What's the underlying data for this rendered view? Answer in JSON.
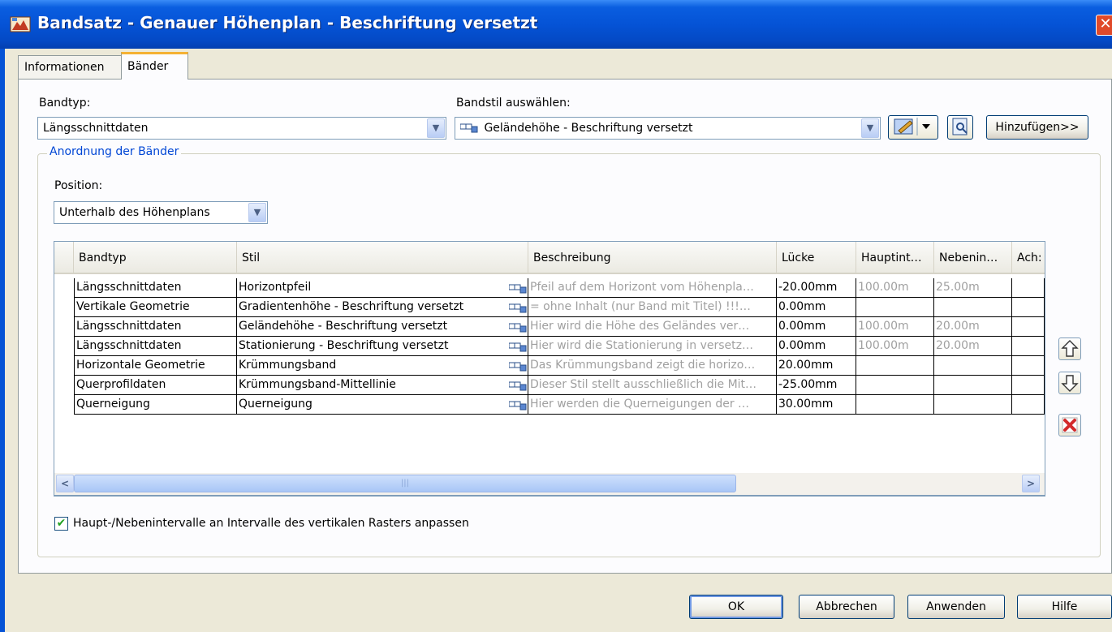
{
  "window": {
    "title": "Bandsatz - Genauer Höhenplan - Beschriftung versetzt",
    "close_glyph": "✕"
  },
  "tabs": [
    {
      "label": "Informationen",
      "active": false
    },
    {
      "label": "Bänder",
      "active": true
    }
  ],
  "band_type": {
    "label": "Bandtyp:",
    "value": "Längsschnittdaten"
  },
  "band_style": {
    "label": "Bandstil auswählen:",
    "value": "Geländehöhe - Beschriftung versetzt",
    "add_button": "Hinzufügen>>"
  },
  "arrangement": {
    "legend": "Anordnung der Bänder",
    "position_label": "Position:",
    "position_value": "Unterhalb des Höhenplans"
  },
  "table": {
    "columns": [
      "Bandtyp",
      "Stil",
      "Beschreibung",
      "Lücke",
      "Hauptint…",
      "Nebenin…",
      "Ach:"
    ],
    "rows": [
      {
        "bandtyp": "Längsschnittdaten",
        "stil": "Horizontpfeil",
        "beschreibung": "Pfeil auf dem Horizont vom Höhenpla…",
        "luecke": "-20.00mm",
        "haupt": "100.00m",
        "neben": "25.00m"
      },
      {
        "bandtyp": "Vertikale Geometrie",
        "stil": "Gradientenhöhe - Beschriftung versetzt",
        "beschreibung": "= ohne Inhalt (nur Band mit Titel) !!!…",
        "luecke": "0.00mm",
        "haupt": "",
        "neben": ""
      },
      {
        "bandtyp": "Längsschnittdaten",
        "stil": "Geländehöhe - Beschriftung versetzt",
        "beschreibung": "Hier wird die Höhe des Geländes ver…",
        "luecke": "0.00mm",
        "haupt": "100.00m",
        "neben": "20.00m"
      },
      {
        "bandtyp": "Längsschnittdaten",
        "stil": "Stationierung - Beschriftung versetzt",
        "beschreibung": "Hier wird die Stationierung in versetz…",
        "luecke": "0.00mm",
        "haupt": "100.00m",
        "neben": "20.00m"
      },
      {
        "bandtyp": "Horizontale Geometrie",
        "stil": "Krümmungsband",
        "beschreibung": "Das Krümmungsband zeigt die horizo…",
        "luecke": "20.00mm",
        "haupt": "",
        "neben": ""
      },
      {
        "bandtyp": "Querprofildaten",
        "stil": "Krümmungsband-Mittellinie",
        "beschreibung": "Dieser Stil stellt ausschließlich die Mit…",
        "luecke": "-25.00mm",
        "haupt": "",
        "neben": ""
      },
      {
        "bandtyp": "Querneigung",
        "stil": "Querneigung",
        "beschreibung": "Hier werden die Querneigungen der …",
        "luecke": "30.00mm",
        "haupt": "",
        "neben": ""
      }
    ]
  },
  "checkbox": {
    "label": "Haupt-/Nebenintervalle an Intervalle des vertikalen Rasters anpassen",
    "checked": true
  },
  "footer": {
    "ok": "OK",
    "cancel": "Abbrechen",
    "apply": "Anwenden",
    "help": "Hilfe"
  },
  "icons": {
    "dropdown": "chevron-down-icon",
    "move_up": "arrow-up-icon",
    "move_down": "arrow-down-icon",
    "delete": "delete-icon",
    "style": "band-style-icon",
    "edit": "edit-style-icon",
    "preview": "preview-icon"
  }
}
